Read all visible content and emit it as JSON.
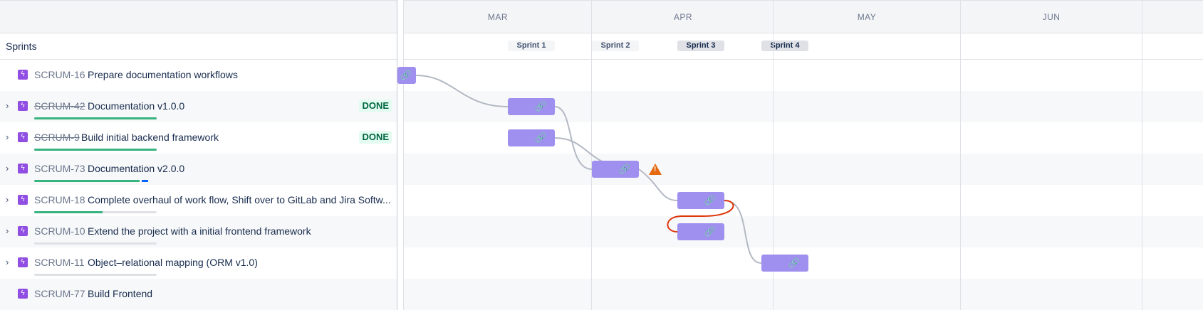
{
  "header": {
    "months": [
      "MAR",
      "APR",
      "MAY",
      "JUN"
    ]
  },
  "sprints": {
    "label": "Sprints",
    "items": [
      {
        "name": "Sprint 1",
        "active": false
      },
      {
        "name": "Sprint 2",
        "active": false
      },
      {
        "name": "Sprint 3",
        "active": true
      },
      {
        "name": "Sprint 4",
        "active": true
      }
    ]
  },
  "issues": [
    {
      "key": "SCRUM-16",
      "summary": "Prepare documentation workflows",
      "expandable": false,
      "key_struck": false,
      "status": null,
      "progress": null
    },
    {
      "key": "SCRUM-42",
      "summary": "Documentation v1.0.0",
      "expandable": true,
      "key_struck": true,
      "status": "DONE",
      "progress": {
        "done": 1.0,
        "in_progress": 0
      }
    },
    {
      "key": "SCRUM-9",
      "summary": "Build initial backend framework",
      "expandable": true,
      "key_struck": true,
      "status": "DONE",
      "progress": {
        "done": 1.0,
        "in_progress": 0
      }
    },
    {
      "key": "SCRUM-73",
      "summary": "Documentation v2.0.0",
      "expandable": true,
      "key_struck": false,
      "status": null,
      "progress": {
        "done": 0.86,
        "in_progress": 0.06
      }
    },
    {
      "key": "SCRUM-18",
      "summary": "Complete overhaul of work flow, Shift over to GitLab and Jira Softw...",
      "expandable": true,
      "key_struck": false,
      "status": null,
      "progress": {
        "done": 0.56,
        "in_progress": 0
      }
    },
    {
      "key": "SCRUM-10",
      "summary": "Extend the project with a initial frontend framework",
      "expandable": true,
      "key_struck": false,
      "status": null,
      "progress": {
        "done": 0,
        "in_progress": 0
      }
    },
    {
      "key": "SCRUM-11",
      "summary": "Object–relational mapping (ORM v1.0)",
      "expandable": true,
      "key_struck": false,
      "status": null,
      "progress": {
        "done": 0,
        "in_progress": 0
      }
    },
    {
      "key": "SCRUM-77",
      "summary": "Build Frontend",
      "expandable": false,
      "key_struck": false,
      "status": null,
      "progress": null
    }
  ],
  "icons": {
    "chevron": "chevron-right-icon",
    "epic": "epic-lightning-icon",
    "link": "link-icon",
    "warning": "warning-icon"
  },
  "colors": {
    "bar": "#9f8fef",
    "epic_icon": "#904ee2",
    "progress_done": "#36b37e",
    "progress_in_progress": "#0065ff",
    "dependency": "#b3b9c4",
    "dependency_conflict": "#de350b",
    "warning": "#e56910",
    "done_lozenge_bg": "#e3fcef",
    "done_lozenge_text": "#006644"
  }
}
